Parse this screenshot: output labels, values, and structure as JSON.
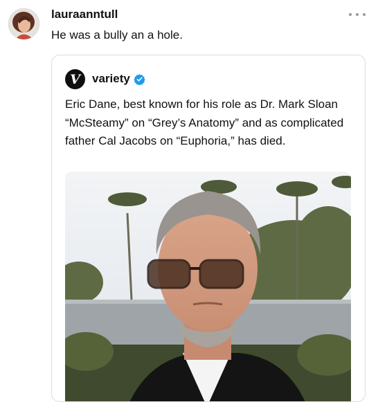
{
  "post": {
    "username": "lauraanntull",
    "text": "He was a bully an a hole.",
    "avatar_icon": "profile-photo",
    "more_icon": "more-options-icon"
  },
  "quoted_post": {
    "username": "variety",
    "avatar_letter": "V",
    "verified": true,
    "text": "Eric Dane, best known for his role as Dr. Mark Sloan “McSteamy” on “Grey’s Anatomy” and as complicated father Cal Jacobs on “Euphoria,” has died.",
    "media": "photo"
  },
  "colors": {
    "verified_blue": "#1d9bf0",
    "card_border": "#dcdcdc",
    "muted_icon": "#999999"
  }
}
